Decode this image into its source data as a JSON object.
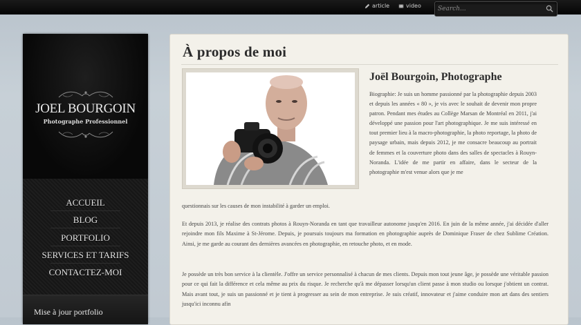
{
  "topbar": {
    "links": [
      {
        "label": "article",
        "icon": "pencil-icon"
      },
      {
        "label": "video",
        "icon": "film-icon"
      }
    ],
    "search": {
      "placeholder": "Search...",
      "value": ""
    }
  },
  "sidebar": {
    "logo": {
      "name": "JOEL BOURGOIN",
      "subtitle": "Photographe Professionnel"
    },
    "nav": [
      {
        "label": "ACCUEIL"
      },
      {
        "label": "BLOG"
      },
      {
        "label": "PORTFOLIO"
      },
      {
        "label": "SERVICES ET TARIFS"
      },
      {
        "label": "CONTACTEZ-MOI"
      }
    ],
    "widget_title": "Mise à jour portfolio"
  },
  "content": {
    "title": "À propos de moi",
    "subheading": "Joël Bourgoin, Photographe",
    "bio": "Biographie: Je suis un homme passionné par la photographie depuis 2003 et depuis les années « 80 », je vis avec le souhait de devenir mon propre patron. Pendant mes études au Collège Marsan de Montréal en 2011, j'ai développé une passion pour l'art photographique. Je me suis intéressé en tout premier lieu à la macro-photographie, la photo reportage, la photo de paysage urbain, mais depuis 2012, je me consacre beaucoup au portrait de femmes et la couverture photo dans des salles de spectacles à Rouyn-Noranda. L'idée de me partir en affaire, dans le secteur de la photographie m'est venue alors que je me",
    "bio_end": "questionnais sur les causes de mon instabilité à garder un emploi.",
    "paragraph2": "Et depuis 2013, je réalise des contrats photos à Rouyn-Noranda en tant que travailleur autonome jusqu'en 2016. En juin de la même année, j'ai décidée d'aller rejoindre mon fils Maxime à St-Jérome. Depuis, je poursuis toujours ma formation en photographie auprès de Dominique Fraser de chez Sublime Création. Ainsi, je me garde au courant des dernières avancées en photographie, en retouche photo, et en mode.",
    "paragraph3": "Je possède un très bon service à la clientèle. J'offre un service personnalisé à chacun de mes clients. Depuis mon tout jeune âge, je possède une véritable passion pour ce qui fait la différence et cela même au prix du risque. Je recherche qu'à me dépasser lorsqu'un client passe à mon studio ou lorsque j'obtient un contrat. Mais avant tout, je suis un passionné et je tient à progresser au sein de mon entreprise. Je suis créatif, innovateur et j'aime conduire mon art dans des sentiers jusqu'ici inconnu afin"
  }
}
